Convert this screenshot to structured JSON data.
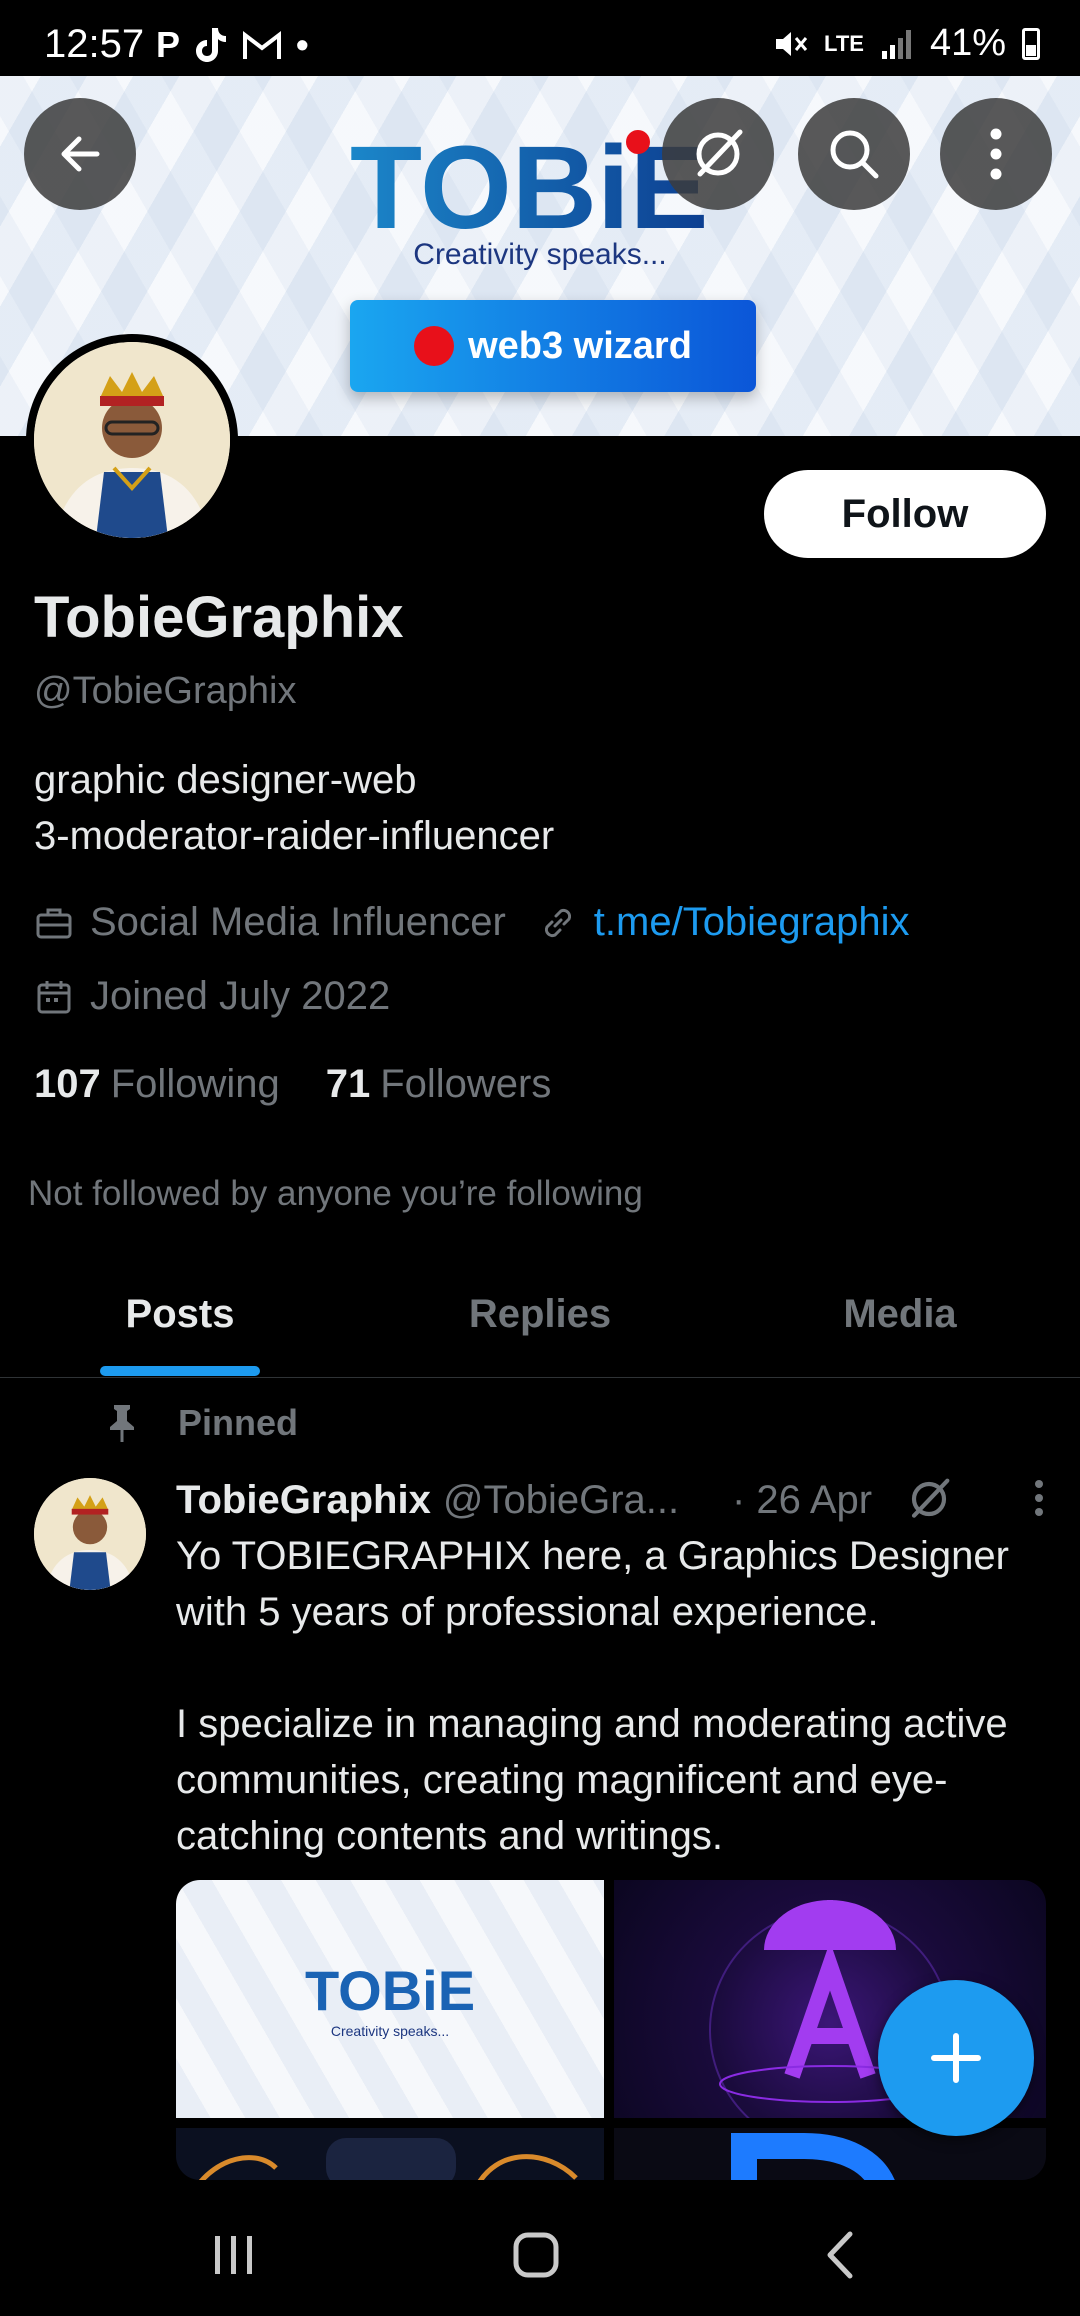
{
  "status_bar": {
    "time": "12:57",
    "notif_icons": [
      "P",
      "tiktok-icon",
      "M",
      "•"
    ],
    "network": "LTE",
    "battery": "41%"
  },
  "banner": {
    "logo_text": "TOBiE",
    "tagline": "Creativity speaks...",
    "badge_text": "web3 wizard"
  },
  "profile": {
    "follow_label": "Follow",
    "name": "TobieGraphix",
    "handle": "@TobieGraphix",
    "bio_line1": "graphic designer-web",
    "bio_line2": "3-moderator-raider-influencer",
    "category": "Social Media Influencer",
    "link": "t.me/Tobiegraphix",
    "joined": "Joined July 2022",
    "following_count": "107",
    "following_label": "Following",
    "followers_count": "71",
    "followers_label": "Followers",
    "not_followed": "Not followed by anyone you’re following"
  },
  "tabs": [
    {
      "label": "Posts",
      "active": true
    },
    {
      "label": "Replies",
      "active": false
    },
    {
      "label": "Media",
      "active": false
    }
  ],
  "post": {
    "pinned_label": "Pinned",
    "author_name": "TobieGraphix",
    "author_handle": "@TobieGra...",
    "date": "· 26 Apr",
    "text_p1": "Yo TOBIEGRAPHIX here, a Graphics Designer with 5 years of professional experience.",
    "text_p2": "I specialize in managing and moderating active communities, creating magnificent and eye-catching contents and writings.",
    "media1_logo": "TOBiE",
    "media1_tagline": "Creativity speaks..."
  },
  "colors": {
    "accent": "#1d9bf0",
    "background": "#000000",
    "text_primary": "#e7e9ea",
    "text_secondary": "#71767b"
  }
}
